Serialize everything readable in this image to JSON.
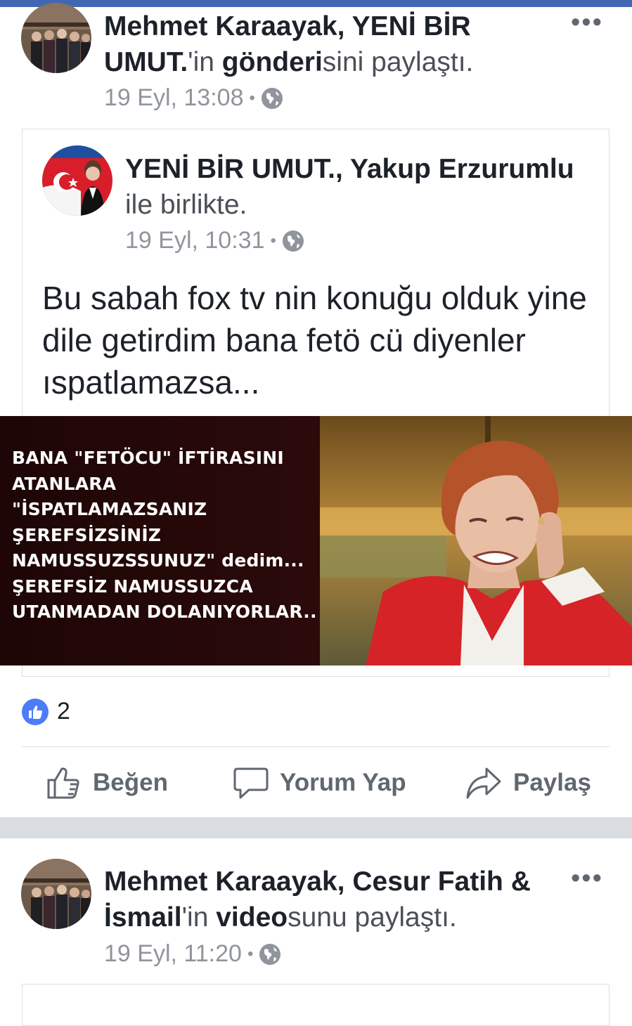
{
  "post1": {
    "author": "Mehmet Karaayak",
    "separator": ", ",
    "shared_page": "YENİ BİR UMUT.",
    "verb_part1": "'in ",
    "object_bold": "gönderi",
    "verb_part2": "sini paylaştı.",
    "timestamp": "19 Eyl, 13:08",
    "privacy_icon": "globe-icon",
    "more_label": "•••"
  },
  "shared_post": {
    "author": "YENİ BİR UMUT.",
    "separator": ", ",
    "tagged": "Yakup Erzurumlu",
    "with_text": "ile birlikte.",
    "timestamp": "19 Eyl, 10:31",
    "body": "Bu sabah fox tv nin konuğu olduk yine dile getirdim bana fetö cü diyenler ıspatlamazsa...",
    "image_caption": "BANA \"FETÖCU\" İFTİRASINI\nATANLARA\n\"İSPATLAMAZSANIZ\nŞEREFSİZSİNİZ\nNAMUSSUZSSUNUZ\" dedim...\nŞEREFSİZ NAMUSSUZCA\nUTANMADAN DOLANIYORLAR.."
  },
  "reactions": {
    "icon": "like-icon",
    "count": "2"
  },
  "actions": {
    "like_label": "Beğen",
    "comment_label": "Yorum Yap",
    "share_label": "Paylaş"
  },
  "post2": {
    "author": "Mehmet Karaayak",
    "separator": ", ",
    "shared_page": "Cesur Fatih & İsmail",
    "verb_part1": "'in ",
    "object_bold": "video",
    "verb_part2": "sunu paylaştı.",
    "timestamp": "19 Eyl, 11:20",
    "privacy_icon": "globe-icon",
    "more_label": "•••"
  },
  "colors": {
    "brand_blue": "#4267b2",
    "like_blue": "#4e7cf6",
    "meta_gray": "#90949c",
    "text_dark": "#1d2129"
  }
}
